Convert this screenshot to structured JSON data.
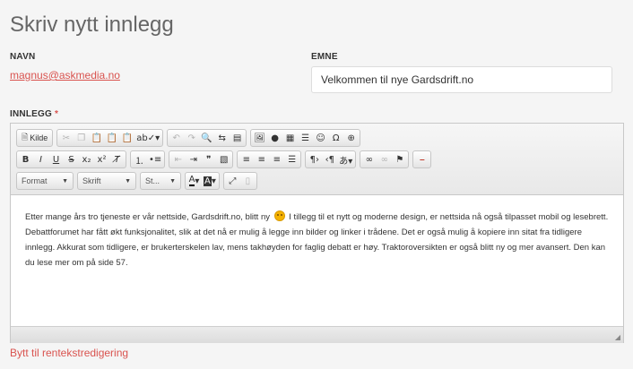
{
  "page": {
    "title": "Skriv nytt innlegg"
  },
  "name_field": {
    "label": "NAVN",
    "value": "magnus@askmedia.no"
  },
  "subject_field": {
    "label": "EMNE",
    "value": "Velkommen til nye Gardsdrift.no"
  },
  "post_field": {
    "label": "INNLEGG",
    "required_marker": "*"
  },
  "toolbar": {
    "source_label": "Kilde",
    "format_label": "Format",
    "font_label": "Skrift",
    "size_label": "St...",
    "icons": {
      "source": "document-icon",
      "cut": "scissors-icon",
      "copy": "copy-icon",
      "paste": "clipboard-icon",
      "spellcheck": "spellcheck-icon",
      "undo": "undo-icon",
      "redo": "redo-icon",
      "find": "search-icon",
      "image": "image-icon",
      "table": "table-icon",
      "smiley": "smiley-icon",
      "special_char": "omega-icon",
      "maximize": "maximize-icon",
      "link": "link-icon",
      "flag": "flag-icon"
    }
  },
  "editor_content": {
    "line1_before": "Etter mange års tro tjeneste er vår nettside, Gardsdrift.no, blitt ny",
    "line1_after": "I tillegg til et nytt og moderne design, er nettsida nå også tilpasset mobil og lesebrett.",
    "line2": "Debattforumet har fått økt funksjonalitet, slik at det nå er mulig å legge inn bilder og linker i trådene. Det er også mulig å kopiere inn sitat fra tidligere",
    "line3": "innlegg. Akkurat som tidligere, er brukerterskelen lav, mens takhøyden for faglig debatt er høy. Traktoroversikten er også blitt ny og mer avansert. Den kan",
    "line4": "du lese mer om på side 57."
  },
  "switch_link": {
    "label": "Bytt til rentekstredigering"
  },
  "colors": {
    "accent": "#d9534f",
    "title": "#666666",
    "background": "#f5f5f5"
  }
}
